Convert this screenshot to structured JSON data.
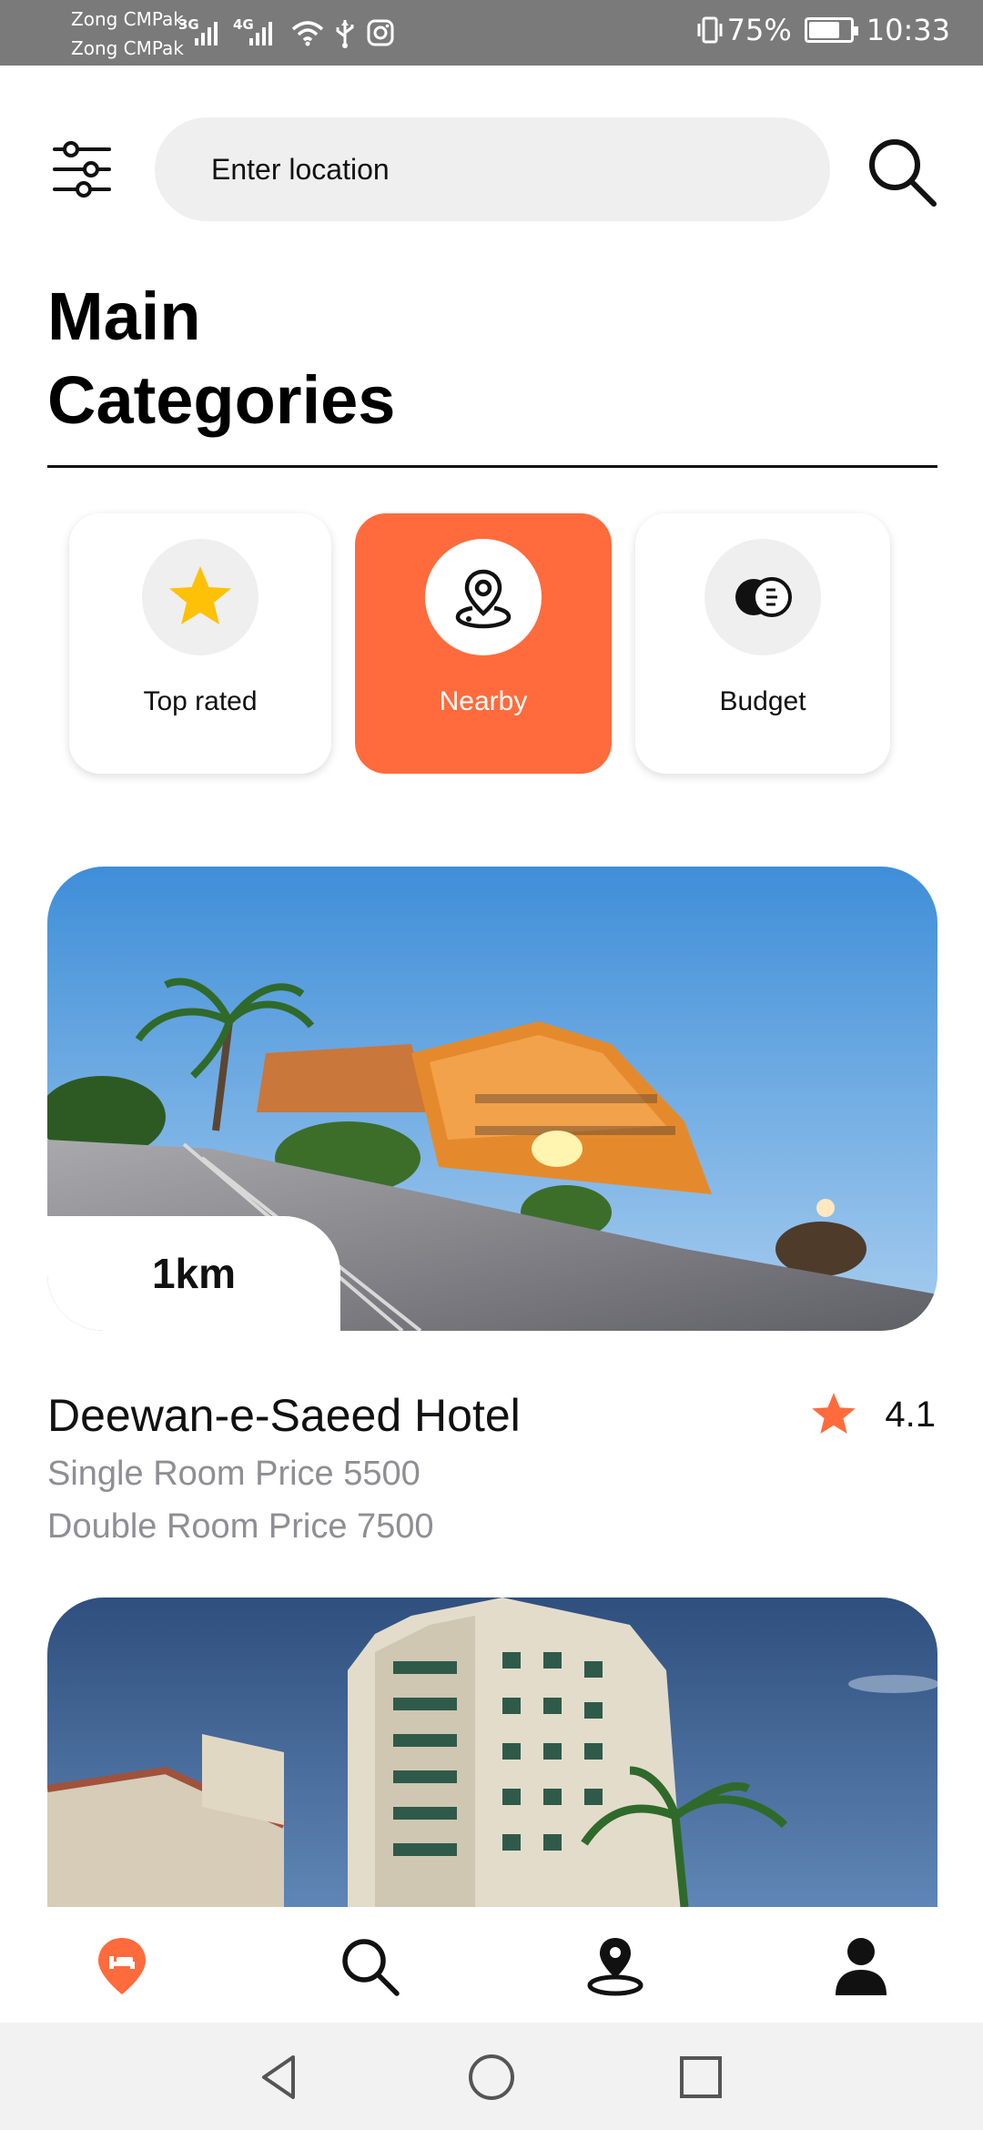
{
  "status_bar": {
    "carrier_1": "Zong CMPak",
    "carrier_2": "Zong CMPak",
    "net_1": "3G",
    "net_2": "4G",
    "battery": "75%",
    "battery_level": 0.75,
    "time": "10:33"
  },
  "search": {
    "placeholder": "Enter location",
    "value": ""
  },
  "heading": {
    "line1": "Main",
    "line2": "Categories"
  },
  "categories": [
    {
      "label": "Top rated",
      "icon": "star-icon",
      "active": false
    },
    {
      "label": "Nearby",
      "icon": "location-pin-icon",
      "active": true
    },
    {
      "label": "Budget",
      "icon": "coins-icon",
      "active": false
    }
  ],
  "hotels": [
    {
      "distance": "1km",
      "name": "Deewan-e-Saeed Hotel",
      "rating": "4.1",
      "single_price": "Single Room Price 5500",
      "double_price": "Double Room Price 7500"
    }
  ],
  "bottom_nav": [
    {
      "icon": "hotel-pin-icon",
      "active": true
    },
    {
      "icon": "search-icon",
      "active": false
    },
    {
      "icon": "map-location-icon",
      "active": false
    },
    {
      "icon": "profile-icon",
      "active": false
    }
  ],
  "colors": {
    "accent": "#ff6b3d",
    "star_yellow": "#ffc107",
    "muted_text": "#8e8e94",
    "field_bg": "#efefef"
  }
}
